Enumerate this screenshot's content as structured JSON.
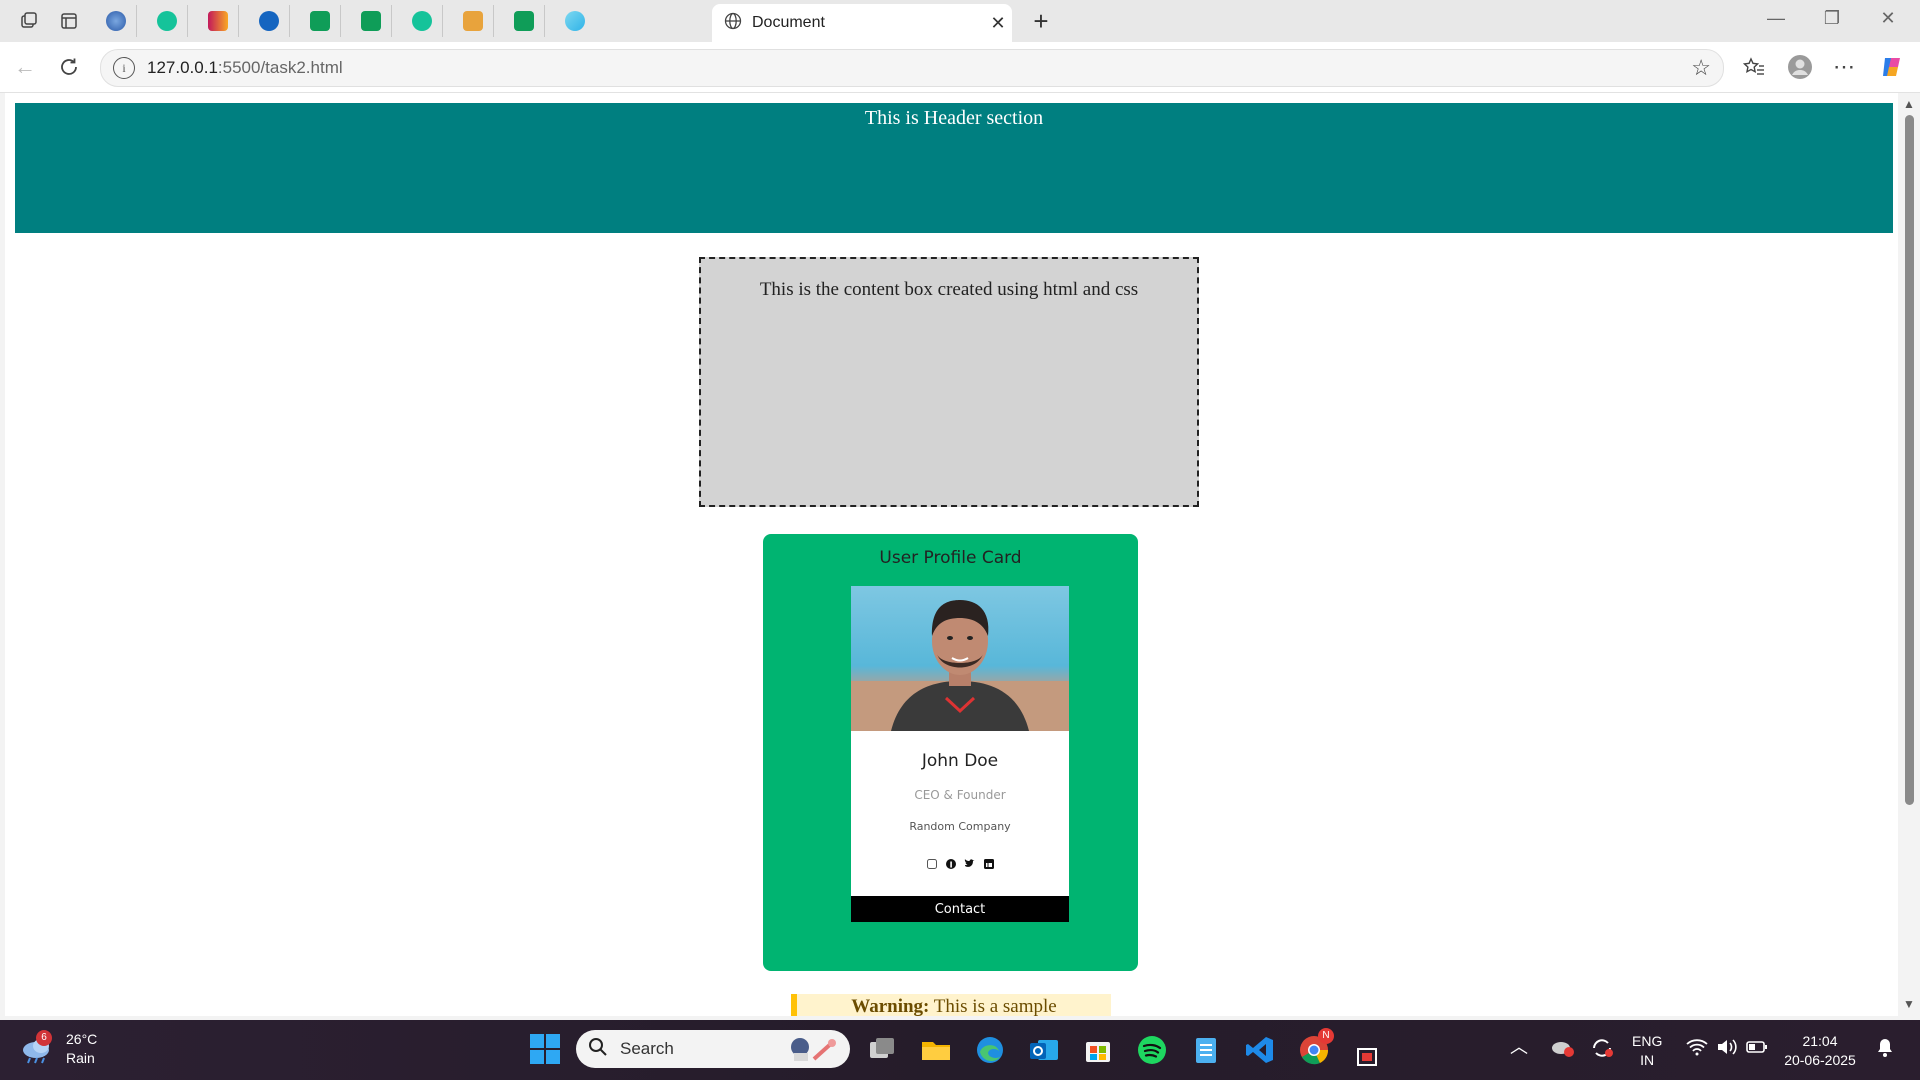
{
  "browser": {
    "tab_title": "Document",
    "url_host": "127.0.0.1",
    "url_rest": ":5500/task2.html"
  },
  "page": {
    "header_text": "This is Header section",
    "content_box_text": "This is the content box created using html and css",
    "profile_card": {
      "title": "User Profile Card",
      "name": "John Doe",
      "role": "CEO & Founder",
      "company": "Random Company",
      "contact_label": "Contact",
      "social_icons": [
        "dribbble-icon",
        "facebook-icon",
        "twitter-icon",
        "linkedin-icon"
      ]
    },
    "warning": {
      "label": "Warning:",
      "text": " This is a sample"
    }
  },
  "taskbar": {
    "weather_temp": "26°C",
    "weather_desc": "Rain",
    "weather_badge": "6",
    "search_label": "Search",
    "lang_top": "ENG",
    "lang_bottom": "IN",
    "time": "21:04",
    "date": "20-06-2025",
    "chrome_badge": "N"
  },
  "colors": {
    "header_bg": "#007f80",
    "content_box_bg": "#d3d3d3",
    "card_bg": "#00b471",
    "warning_bg": "#fff3cd",
    "warning_border": "#ffc107"
  }
}
